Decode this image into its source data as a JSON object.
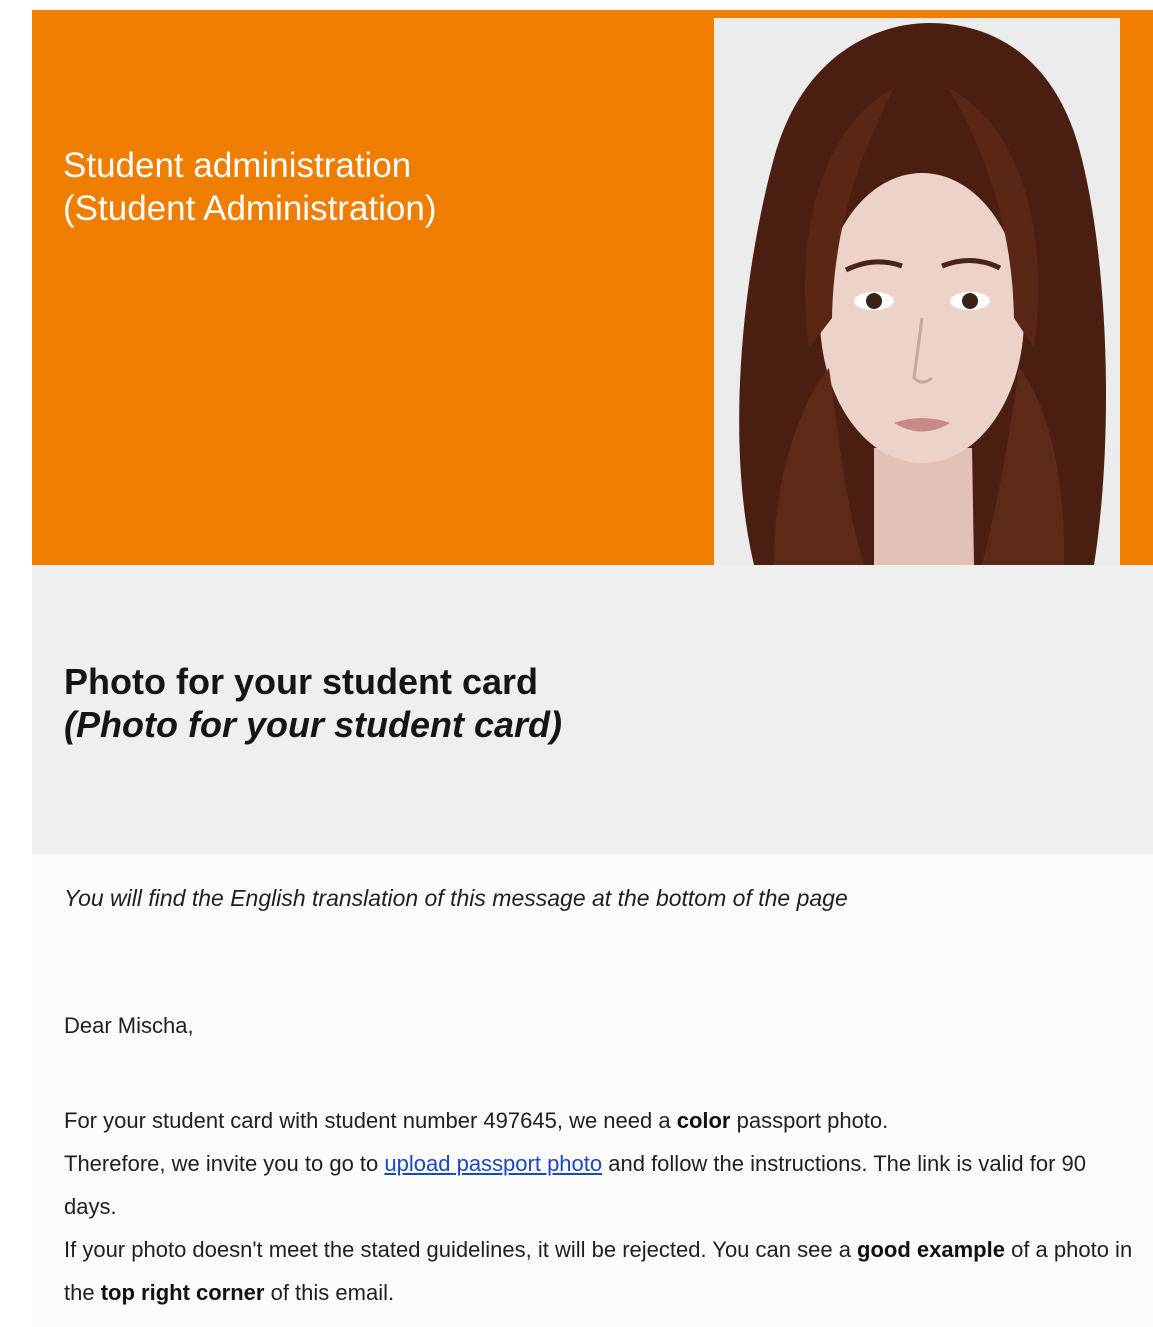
{
  "header": {
    "title_line1": "Student administration",
    "title_line2": "(Student Administration)",
    "brand_color": "#ef7d00"
  },
  "photo": {
    "icon": "passport-photo-example"
  },
  "section": {
    "title_line1": "Photo for your student card",
    "title_line2": "(Photo for your student card)"
  },
  "body": {
    "translation_note": "You will find the English translation of this message at the bottom of the page",
    "greeting": "Dear Mischa,",
    "p1_a": "For your student card with student number 497645, we need a ",
    "p1_bold": "color",
    "p1_b": " passport photo.",
    "p2_a": "Therefore, we invite you to go to ",
    "p2_link": "upload passport photo",
    "p2_b": " and follow the instructions. The link is valid for 90 days.",
    "p3_a": "If your photo doesn't meet the stated guidelines, it will be rejected. You can see a ",
    "p3_bold1": "good example",
    "p3_b": " of a photo in the ",
    "p3_bold2": "top right corner",
    "p3_c": " of this email.",
    "link_color": "#1a47c8"
  }
}
